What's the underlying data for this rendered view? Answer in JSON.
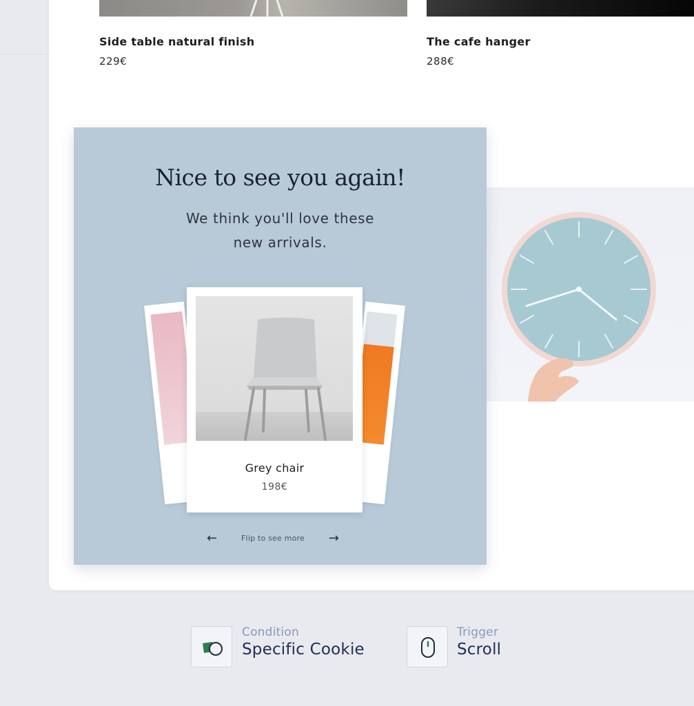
{
  "products": [
    {
      "name": "Side table natural finish",
      "price": "229€"
    },
    {
      "name": "The cafe hanger",
      "price": "288€"
    }
  ],
  "popup": {
    "title": "Nice to see you again!",
    "subtitle_line1": "We think you'll love these",
    "subtitle_line2": "new arrivals.",
    "card": {
      "name": "Grey chair",
      "price": "198€"
    },
    "flip_label": "Flip to see more",
    "prev_arrow": "←",
    "next_arrow": "→"
  },
  "condition": {
    "label": "Condition",
    "value": "Specific Cookie",
    "icon": "cookie-icon"
  },
  "trigger": {
    "label": "Trigger",
    "value": "Scroll",
    "icon": "mouse-icon"
  },
  "colors": {
    "popup_bg": "#b8cad8",
    "accent_dark": "#1f2d5c",
    "accent_light": "#8a96c0",
    "cookie_green": "#2e7d4f"
  }
}
